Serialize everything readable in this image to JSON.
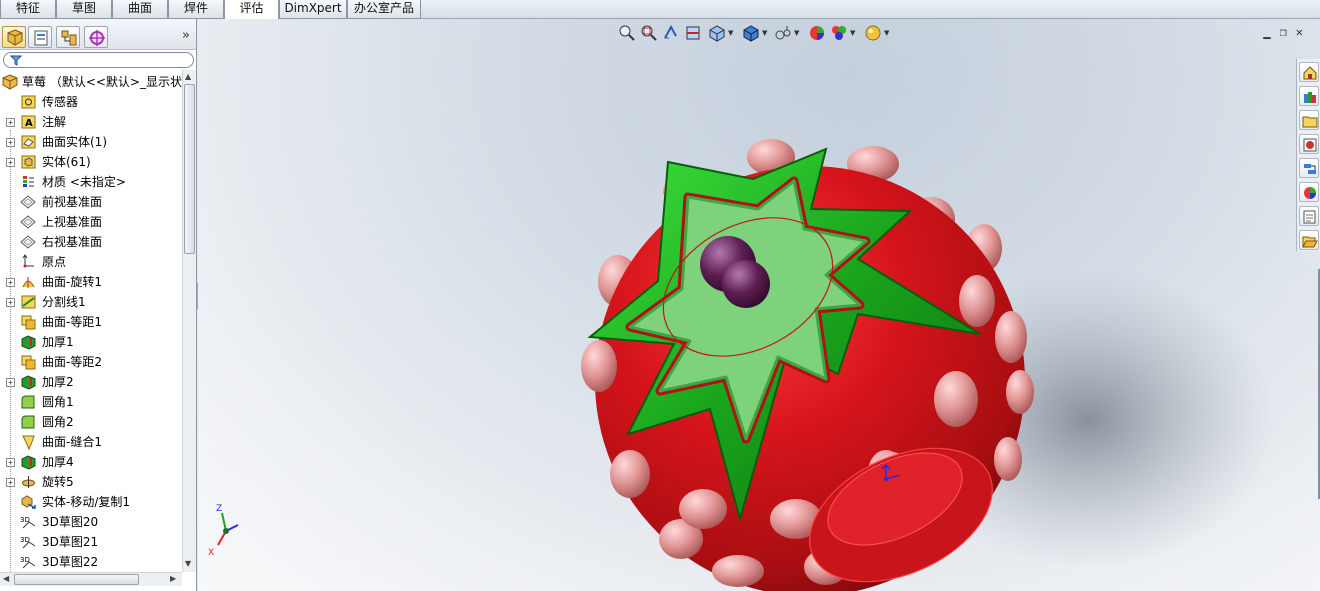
{
  "tabs": [
    {
      "label": "特征",
      "active": false
    },
    {
      "label": "草图",
      "active": false
    },
    {
      "label": "曲面",
      "active": false
    },
    {
      "label": "焊件",
      "active": false
    },
    {
      "label": "评估",
      "active": true
    },
    {
      "label": "DimXpert",
      "active": false
    },
    {
      "label": "办公室产品",
      "active": false
    }
  ],
  "feature_manager": {
    "toolbar_icons": [
      "feature-tree-icon",
      "property-manager-icon",
      "configuration-manager-icon",
      "dimxpert-manager-icon"
    ],
    "expand_glyph": "»",
    "filter_icon": "filter-icon",
    "root": {
      "label": "草莓 （默认<<默认>_显示状态",
      "icon": "part-icon"
    },
    "items": [
      {
        "label": "传感器",
        "icon": "sensor-icon",
        "expandable": false
      },
      {
        "label": "注解",
        "icon": "annotation-icon",
        "expandable": true
      },
      {
        "label": "曲面实体(1)",
        "icon": "surface-bodies-icon",
        "expandable": true
      },
      {
        "label": "实体(61)",
        "icon": "solid-bodies-icon",
        "expandable": true
      },
      {
        "label": "材质 <未指定>",
        "icon": "material-icon",
        "expandable": false
      },
      {
        "label": "前视基准面",
        "icon": "plane-icon",
        "expandable": false
      },
      {
        "label": "上视基准面",
        "icon": "plane-icon",
        "expandable": false
      },
      {
        "label": "右视基准面",
        "icon": "plane-icon",
        "expandable": false
      },
      {
        "label": "原点",
        "icon": "origin-icon",
        "expandable": false
      },
      {
        "label": "曲面-旋转1",
        "icon": "revolve-surface-icon",
        "expandable": true
      },
      {
        "label": "分割线1",
        "icon": "split-line-icon",
        "expandable": true
      },
      {
        "label": "曲面-等距1",
        "icon": "offset-surface-icon",
        "expandable": false
      },
      {
        "label": "加厚1",
        "icon": "thicken-icon",
        "expandable": false
      },
      {
        "label": "曲面-等距2",
        "icon": "offset-surface-icon",
        "expandable": false
      },
      {
        "label": "加厚2",
        "icon": "thicken-icon",
        "expandable": true
      },
      {
        "label": "圆角1",
        "icon": "fillet-icon",
        "expandable": false
      },
      {
        "label": "圆角2",
        "icon": "fillet-icon",
        "expandable": false
      },
      {
        "label": "曲面-缝合1",
        "icon": "knit-surface-icon",
        "expandable": false
      },
      {
        "label": "加厚4",
        "icon": "thicken-icon",
        "expandable": true
      },
      {
        "label": "旋转5",
        "icon": "revolve-icon",
        "expandable": true
      },
      {
        "label": "实体-移动/复制1",
        "icon": "move-copy-body-icon",
        "expandable": false
      },
      {
        "label": "3D草图20",
        "icon": "3d-sketch-icon",
        "expandable": false
      },
      {
        "label": "3D草图21",
        "icon": "3d-sketch-icon",
        "expandable": false
      },
      {
        "label": "3D草图22",
        "icon": "3d-sketch-icon",
        "expandable": false
      }
    ]
  },
  "viewport": {
    "headsup_icons": [
      "zoom-to-fit-icon",
      "zoom-to-area-icon",
      "previous-view-icon",
      "section-view-icon",
      "view-orientation-icon",
      "display-style-icon",
      "hide-show-items-icon",
      "edit-appearance-icon",
      "apply-scene-icon",
      "view-settings-icon"
    ],
    "window_controls": [
      "minimize-icon",
      "restore-icon",
      "close-icon"
    ],
    "triad_labels": {
      "z": "Z",
      "x": "X"
    },
    "colors": {
      "body": "#c8111a",
      "leaf": "#1ba21e",
      "seed": "#d98a8a",
      "stem": "#5a1a4c"
    }
  },
  "task_pane": [
    "home-icon",
    "design-library-icon",
    "file-explorer-icon",
    "view-palette-icon",
    "search-icon",
    "appearances-icon",
    "custom-properties-icon",
    "open-folder-icon"
  ]
}
